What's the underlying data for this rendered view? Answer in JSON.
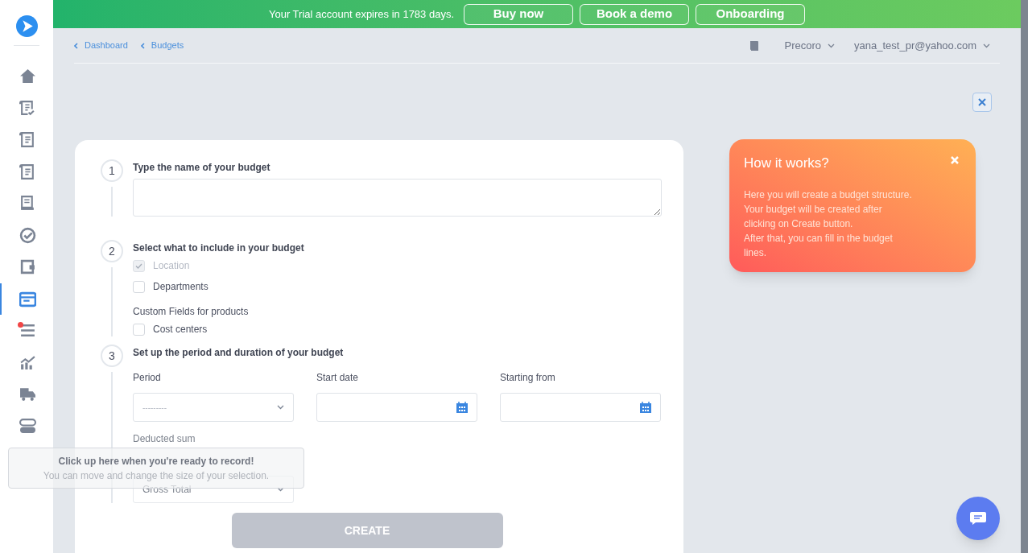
{
  "sidebar": {
    "items": [
      {
        "selected": false,
        "notification": false
      },
      {
        "selected": false,
        "notification": false
      },
      {
        "selected": false,
        "notification": false
      },
      {
        "selected": false,
        "notification": false
      },
      {
        "selected": false,
        "notification": false
      },
      {
        "selected": false,
        "notification": false
      },
      {
        "selected": false,
        "notification": false
      },
      {
        "selected": true,
        "notification": false
      },
      {
        "selected": false,
        "notification": true
      },
      {
        "selected": false,
        "notification": false
      },
      {
        "selected": false,
        "notification": false
      },
      {
        "selected": false,
        "notification": false
      }
    ]
  },
  "banner": {
    "text": "Your Trial account expires in 1783 days.",
    "buttons": [
      "Buy now",
      "Book a demo",
      "Onboarding"
    ]
  },
  "breadcrumbs": [
    "Dashboard",
    "Budgets"
  ],
  "header": {
    "company": "Precoro",
    "user": "yana_test_pr@yahoo.com"
  },
  "steps": [
    {
      "number": "1",
      "title": "Type the name of your budget"
    },
    {
      "number": "2",
      "title": "Select what to include in your budget",
      "options": [
        {
          "label": "Location",
          "checked": true,
          "disabled": true
        },
        {
          "label": "Departments",
          "checked": false,
          "disabled": false
        }
      ],
      "group_label": "Custom Fields for products",
      "group_options": [
        {
          "label": "Cost centers",
          "checked": false,
          "disabled": false
        }
      ]
    },
    {
      "number": "3",
      "title": "Set up the period and duration of your budget",
      "fields": [
        {
          "kind": "select",
          "label": "Period",
          "placeholder": "---------"
        },
        {
          "kind": "date",
          "label": "Start date"
        },
        {
          "kind": "date",
          "label": "Starting from"
        }
      ],
      "deducted": {
        "label": "Deducted sum",
        "value": "Gross Total"
      }
    }
  ],
  "create_button": {
    "label": "CREATE",
    "disabled": true
  },
  "tooltip": {
    "title": "How it works?",
    "body": "Here you will create a budget structure.\nYour budget will be created after\nclicking on Create button.\nAfter that, you can fill in the budget\nlines."
  },
  "recorder_overlay": {
    "title": "Click up here when you're ready to record!",
    "subtitle": "You can move and change the size of your selection."
  }
}
